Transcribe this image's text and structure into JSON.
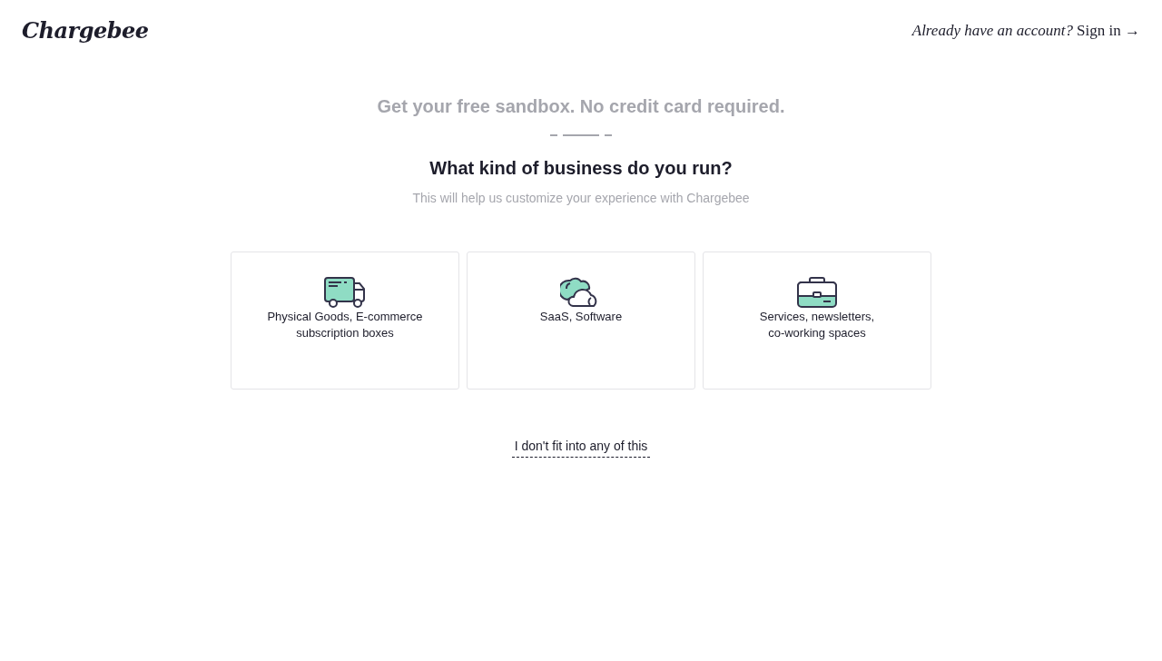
{
  "header": {
    "logo": "Chargebee",
    "prompt": "Already have an account?",
    "sign_in_link": "Sign in →"
  },
  "headline": "Get your free sandbox. No credit card required.",
  "question": "What kind of business do you run?",
  "subtitle": "This will help us customize your experience with Chargebee",
  "options": [
    {
      "kind": "truck",
      "lines": [
        "Physical Goods, E-commerce",
        "subscription boxes"
      ]
    },
    {
      "kind": "cloud",
      "lines": [
        "SaaS, Software"
      ]
    },
    {
      "kind": "briefcase",
      "lines": [
        "Services, newsletters,",
        "co-working spaces"
      ]
    }
  ],
  "skip_link": "I don't fit into any of this"
}
